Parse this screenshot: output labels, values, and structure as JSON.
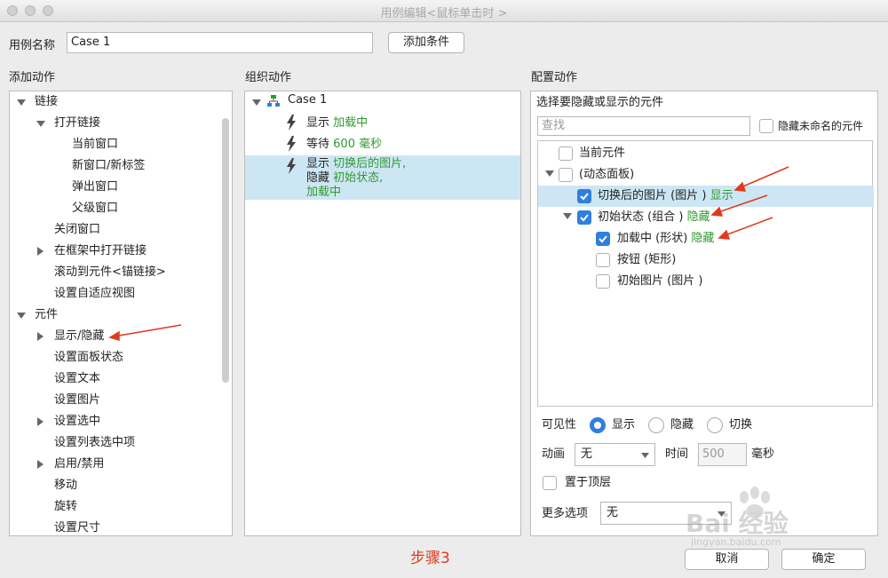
{
  "window": {
    "title": "用例编辑<鼠标单击时 >"
  },
  "case_name": {
    "label": "用例名称",
    "value": "Case 1",
    "add_condition": "添加条件"
  },
  "add_actions": {
    "header": "添加动作",
    "items": [
      {
        "label": "链接"
      },
      {
        "label": "打开链接"
      },
      {
        "label": "当前窗口"
      },
      {
        "label": "新窗口/新标签"
      },
      {
        "label": "弹出窗口"
      },
      {
        "label": "父级窗口"
      },
      {
        "label": "关闭窗口"
      },
      {
        "label": "在框架中打开链接"
      },
      {
        "label": "滚动到元件<锚链接>"
      },
      {
        "label": "设置自适应视图"
      },
      {
        "label": "元件"
      },
      {
        "label": "显示/隐藏"
      },
      {
        "label": "设置面板状态"
      },
      {
        "label": "设置文本"
      },
      {
        "label": "设置图片"
      },
      {
        "label": "设置选中"
      },
      {
        "label": "设置列表选中项"
      },
      {
        "label": "启用/禁用"
      },
      {
        "label": "移动"
      },
      {
        "label": "旋转"
      },
      {
        "label": "设置尺寸"
      }
    ]
  },
  "organize": {
    "header": "组织动作",
    "case": "Case 1",
    "actions": [
      {
        "verb": "显示",
        "target": "加载中"
      },
      {
        "verb": "等待",
        "target": "600 毫秒"
      },
      {
        "verb": "显示",
        "target": "切换后的图片,"
      },
      {
        "verb": "隐藏",
        "target": "初始状态,"
      },
      {
        "verb": "",
        "target": "加载中"
      }
    ]
  },
  "config": {
    "header": "配置动作",
    "prompt": "选择要隐藏或显示的元件",
    "search_placeholder": "查找",
    "hide_unnamed": "隐藏未命名的元件",
    "tree": [
      {
        "label": "当前元件",
        "state": ""
      },
      {
        "label": "(动态面板)",
        "state": ""
      },
      {
        "label": "切换后的图片 (图片 )",
        "state": "显示"
      },
      {
        "label": "初始状态 (组合 )",
        "state": "隐藏"
      },
      {
        "label": "加载中 (形状)",
        "state": "隐藏"
      },
      {
        "label": "按钮 (矩形)",
        "state": ""
      },
      {
        "label": "初始图片 (图片 )",
        "state": ""
      }
    ],
    "visibility_label": "可见性",
    "visibility_options": [
      "显示",
      "隐藏",
      "切换"
    ],
    "animation_label": "动画",
    "animation_value": "无",
    "time_label": "时间",
    "time_value": "500",
    "time_unit": "毫秒",
    "bring_to_front": "置于顶层",
    "more_options_label": "更多选项",
    "more_options_value": "无"
  },
  "footer": {
    "step": "步骤3",
    "cancel": "取消",
    "ok": "确定"
  },
  "watermark": {
    "brand": "Bai 经验",
    "url": "jingyan.baidu.com"
  },
  "colors": {
    "accent": "#2f7fe0",
    "green": "#2f9a2f",
    "annotation": "#e03a1e",
    "selected_row": "#cde6f4"
  }
}
